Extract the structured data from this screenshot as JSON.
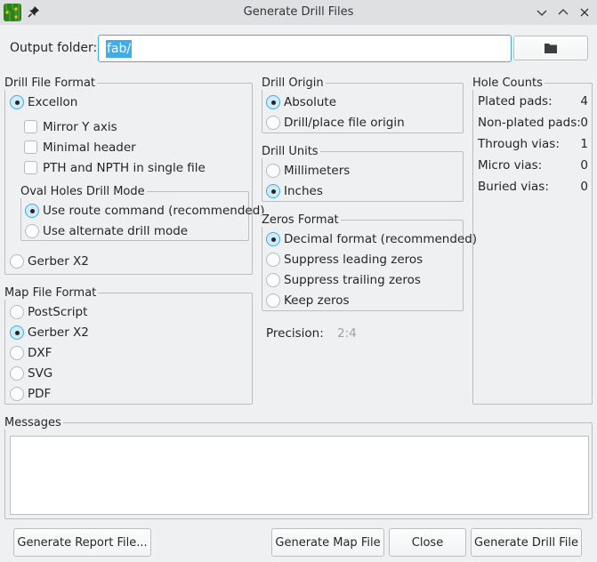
{
  "window": {
    "title": "Generate Drill Files",
    "icons": [
      "app-pcb-icon",
      "pin-icon",
      "minimize-icon",
      "maximize-icon",
      "close-icon"
    ]
  },
  "output": {
    "label": "Output folder:",
    "value": "fab/",
    "browse_icon": "folder-icon"
  },
  "drill_file_format": {
    "title": "Drill File Format",
    "excellon_label": "Excellon",
    "excellon_selected": true,
    "checkboxes": [
      {
        "label": "Mirror Y axis",
        "checked": false
      },
      {
        "label": "Minimal header",
        "checked": false
      },
      {
        "label": "PTH and NPTH in single file",
        "checked": false
      }
    ],
    "oval_holes": {
      "title": "Oval Holes Drill Mode",
      "options": [
        {
          "label": "Use route command (recommended)",
          "selected": true
        },
        {
          "label": "Use alternate drill mode",
          "selected": false
        }
      ]
    },
    "gerber_label": "Gerber X2",
    "gerber_selected": false
  },
  "map_file_format": {
    "title": "Map File Format",
    "options": [
      {
        "label": "PostScript",
        "selected": false
      },
      {
        "label": "Gerber X2",
        "selected": true
      },
      {
        "label": "DXF",
        "selected": false
      },
      {
        "label": "SVG",
        "selected": false
      },
      {
        "label": "PDF",
        "selected": false
      }
    ]
  },
  "drill_origin": {
    "title": "Drill Origin",
    "options": [
      {
        "label": "Absolute",
        "selected": true
      },
      {
        "label": "Drill/place file origin",
        "selected": false
      }
    ]
  },
  "drill_units": {
    "title": "Drill Units",
    "options": [
      {
        "label": "Millimeters",
        "selected": false
      },
      {
        "label": "Inches",
        "selected": true
      }
    ]
  },
  "zeros_format": {
    "title": "Zeros Format",
    "options": [
      {
        "label": "Decimal format (recommended)",
        "selected": true
      },
      {
        "label": "Suppress leading zeros",
        "selected": false
      },
      {
        "label": "Suppress trailing zeros",
        "selected": false
      },
      {
        "label": "Keep zeros",
        "selected": false
      }
    ]
  },
  "precision": {
    "label": "Precision:",
    "value": "2:4"
  },
  "hole_counts": {
    "title": "Hole Counts",
    "rows": [
      {
        "label": "Plated pads:",
        "value": "4"
      },
      {
        "label": "Non-plated pads:",
        "value": "0"
      },
      {
        "label": "Through vias:",
        "value": "1"
      },
      {
        "label": "Micro vias:",
        "value": "0"
      },
      {
        "label": "Buried vias:",
        "value": "0"
      }
    ]
  },
  "messages": {
    "title": "Messages",
    "content": ""
  },
  "buttons": {
    "report": "Generate Report File...",
    "map": "Generate Map File",
    "close": "Close",
    "drill": "Generate Drill File"
  },
  "colors": {
    "accent": "#3daee9",
    "window_bg": "#eff0f1",
    "titlebar_bg": "#dee0e2"
  }
}
